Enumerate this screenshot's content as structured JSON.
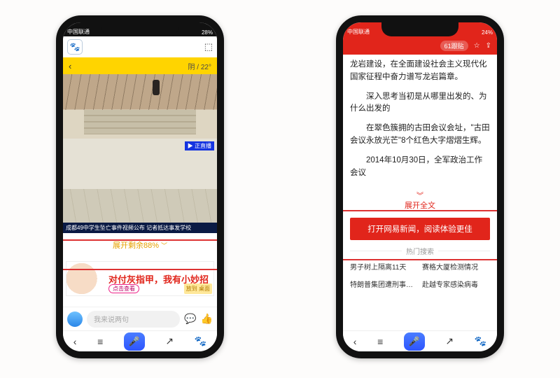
{
  "left": {
    "status": {
      "carrier": "中国联通",
      "battery": "28%"
    },
    "weather": "阴 / 22°",
    "caption": "成都49中学生坠亡事件视频公布 记者抵达事发学校",
    "video_tag": "▶ 正直播",
    "expand_label": "展开剩余88%",
    "ad": {
      "text": "对付灰指甲，我有小妙招",
      "pill": "点击查看",
      "corner": "放到\n桌面"
    },
    "say_placeholder": "我来说两句",
    "nav_icons": [
      "back",
      "menu",
      "mic",
      "share",
      "paw"
    ]
  },
  "right": {
    "status": {
      "carrier": "中国联通",
      "battery": "24%"
    },
    "header_pill": "61跟贴",
    "paragraphs": [
      "龙岩建设，在全面建设社会主义现代化国家征程中奋力谱写龙岩篇章。",
      "深入思考当初是从哪里出发的、为什么出发的",
      "在翠色簇拥的古田会议会址，\"古田会议永放光芒\"8个红色大字熠熠生辉。",
      "2014年10月30日，全军政治工作会议"
    ],
    "expand_label": "展开全文",
    "open_app_label": "打开网易新闻，阅读体验更佳",
    "hot_title": "热门搜索",
    "hot_items": [
      "男子树上隔离11天",
      "赛格大厦检测情况",
      "特朗普集团遭刑事调查",
      "赴越专家感染病毒"
    ]
  }
}
